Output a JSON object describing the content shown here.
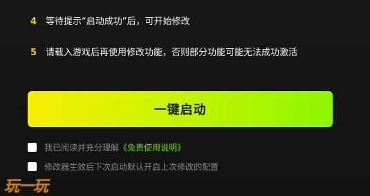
{
  "steps": [
    {
      "num": "4",
      "text": "等待提示“启动成功”后，可开始修改"
    },
    {
      "num": "5",
      "text": "请载入游戏后再使用修改功能，否则部分功能可能无法成功激活"
    }
  ],
  "launch_button": {
    "label": "一键启动"
  },
  "agreement": {
    "prefix": "我已阅读并充分理解",
    "link": "《免责使用说明》"
  },
  "auto_enable": {
    "label": "修改器生效后下次启动默认开启上次修改的配置"
  },
  "watermark": {
    "text": "玩一玩"
  },
  "colors": {
    "accent_number": "#f4c21a",
    "button_gradient_start": "#f7ef00",
    "button_gradient_end": "#8ef500",
    "link": "#7ed321",
    "background": "#151515"
  }
}
